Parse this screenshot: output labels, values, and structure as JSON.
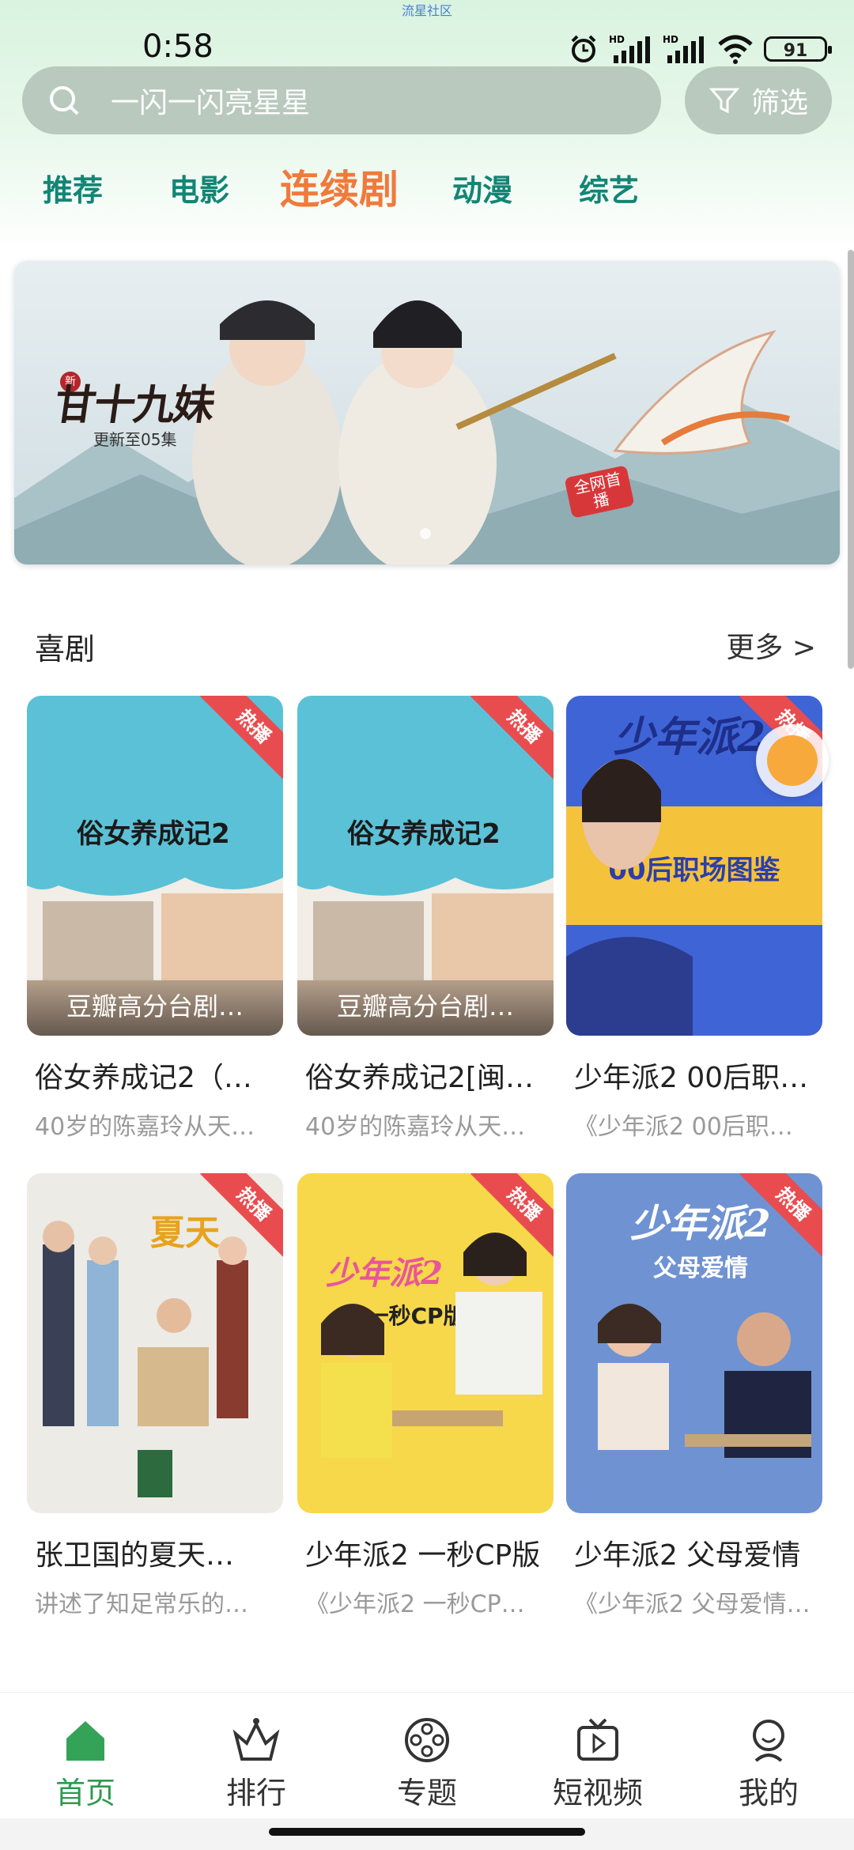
{
  "app_label": "流星社区",
  "status_bar": {
    "time": "0:58",
    "battery": "91",
    "signal_labels": [
      "HD",
      "HD"
    ]
  },
  "search": {
    "placeholder": "一闪一闪亮星星",
    "filter_label": "筛选"
  },
  "tabs": [
    {
      "label": "推荐",
      "active": false
    },
    {
      "label": "电影",
      "active": false
    },
    {
      "label": "连续剧",
      "active": true
    },
    {
      "label": "动漫",
      "active": false
    },
    {
      "label": "综艺",
      "active": false
    }
  ],
  "banner": {
    "title": "甘十九妹",
    "badge": "新",
    "update": "更新至05集",
    "tag": "全网首播"
  },
  "section": {
    "title": "喜剧",
    "more": "更多 >"
  },
  "hot_label": "热播",
  "cards": [
    {
      "title": "俗女养成记2（…",
      "desc": "40岁的陈嘉玲从天…",
      "caption": "豆瓣高分台剧…",
      "poster": "sunu"
    },
    {
      "title": "俗女养成记2[闽…",
      "desc": "40岁的陈嘉玲从天…",
      "caption": "豆瓣高分台剧…",
      "poster": "sunu"
    },
    {
      "title": "少年派2 00后职…",
      "desc": "《少年派2 00后职…",
      "caption": "",
      "poster": "shaonian-blue"
    },
    {
      "title": "张卫国的夏天…",
      "desc": "讲述了知足常乐的…",
      "caption": "",
      "poster": "zhang"
    },
    {
      "title": "少年派2 一秒CP版",
      "desc": "《少年派2 一秒CP…",
      "caption": "",
      "poster": "shaonian-yellow"
    },
    {
      "title": "少年派2 父母爱情",
      "desc": "《少年派2 父母爱情…",
      "caption": "",
      "poster": "shaonian-parents"
    }
  ],
  "bottom_nav": [
    {
      "label": "首页",
      "icon": "home-icon",
      "active": true
    },
    {
      "label": "排行",
      "icon": "ranking-icon",
      "active": false
    },
    {
      "label": "专题",
      "icon": "film-reel-icon",
      "active": false
    },
    {
      "label": "短视频",
      "icon": "tv-play-icon",
      "active": false
    },
    {
      "label": "我的",
      "icon": "profile-icon",
      "active": false
    }
  ],
  "colors": {
    "accent_green": "#2e9a4e",
    "tab_teal": "#138575",
    "tab_active": "#f07a3b",
    "hot_red": "#e84c4f"
  }
}
